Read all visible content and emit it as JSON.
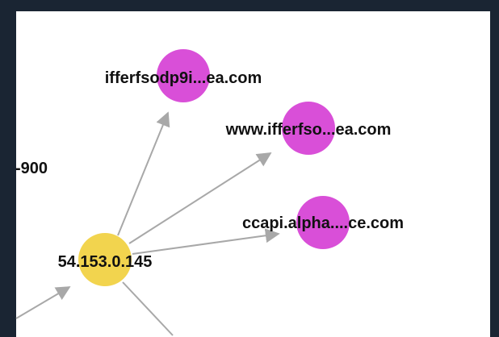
{
  "graph": {
    "nodes": [
      {
        "id": "ip",
        "label": "54.153.0.145",
        "kind": "ip",
        "color": "#f2d44e"
      },
      {
        "id": "d1",
        "label": "ifferfsodp9i...ea.com",
        "kind": "domain",
        "color": "#d94fd8"
      },
      {
        "id": "d2",
        "label": "www.ifferfso...ea.com",
        "kind": "domain",
        "color": "#d94fd8"
      },
      {
        "id": "d3",
        "label": "ccapi.alpha....ce.com",
        "kind": "domain",
        "color": "#d94fd8"
      }
    ],
    "partial_labels": [
      {
        "id": "partial-left",
        "label": "-900"
      }
    ],
    "edges": [
      {
        "from": "ip",
        "to": "d1"
      },
      {
        "from": "ip",
        "to": "d2"
      },
      {
        "from": "ip",
        "to": "d3"
      },
      {
        "from": "offscreen-left",
        "to": "ip"
      },
      {
        "from": "ip",
        "to": "offscreen-bottom"
      }
    ],
    "colors": {
      "edge": "#a8a8a8",
      "background": "#ffffff",
      "frame": "#1a2533"
    }
  }
}
